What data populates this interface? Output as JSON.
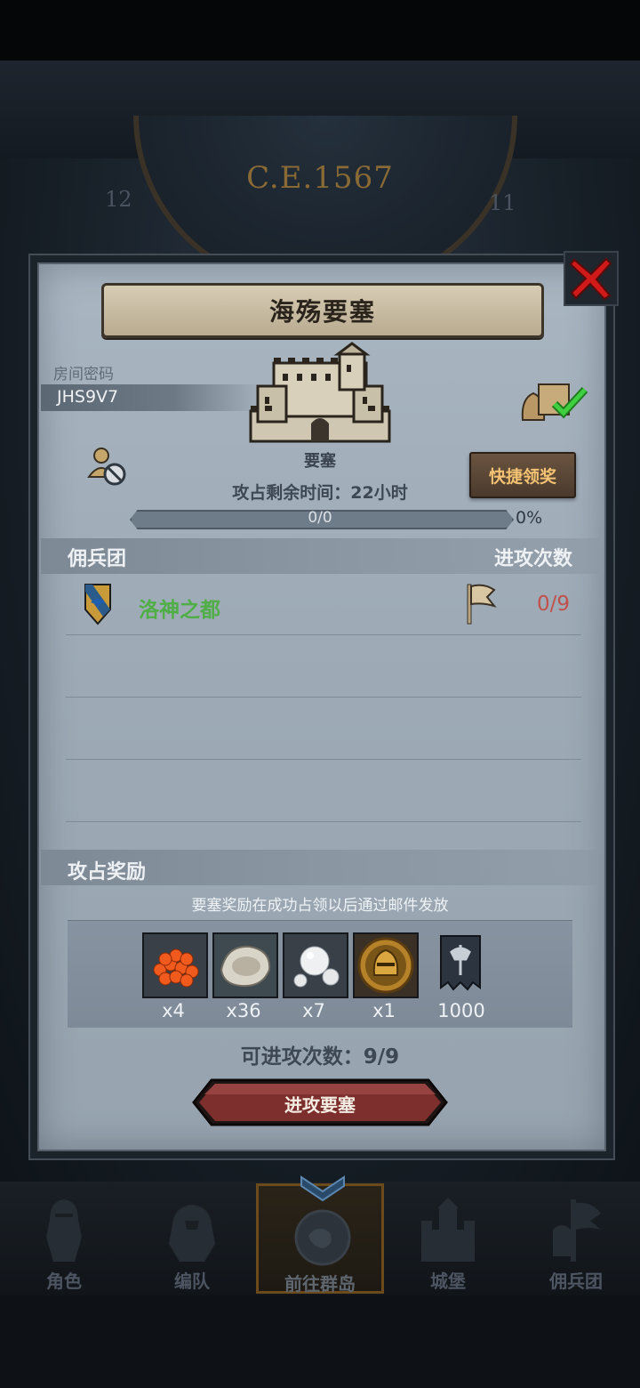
{
  "header": {
    "era": "C.E.1567",
    "dial_left": "12",
    "dial_right": "11"
  },
  "dialog": {
    "title": "海殇要塞",
    "room_label": "房间密码",
    "room_code": "JHS9V7",
    "fortress_name": "要塞",
    "quick_claim": "快捷领奖",
    "remaining_time": "攻占剩余时间：22小时",
    "progress": {
      "text": "0/0",
      "percent_text": "0%",
      "fraction": 0
    },
    "guild_header": "佣兵团",
    "attacks_header": "进攻次数",
    "guilds": [
      {
        "name": "洛神之都",
        "attacks": "0/9"
      }
    ],
    "reward_header": "攻占奖励",
    "reward_note": "要塞奖励在成功占领以后通过邮件发放",
    "rewards": [
      {
        "icon": "salmon-roe-icon",
        "qty": "x4"
      },
      {
        "icon": "oyster-icon",
        "qty": "x36"
      },
      {
        "icon": "pearl-icon",
        "qty": "x7"
      },
      {
        "icon": "knight-helmet-coin-icon",
        "qty": "x1"
      },
      {
        "icon": "war-banner-icon",
        "qty": "1000"
      }
    ],
    "can_attack": "可进攻次数：9/9",
    "attack_button": "进攻要塞"
  },
  "nav": [
    {
      "label": "角色",
      "icon": "knight-icon"
    },
    {
      "label": "编队",
      "icon": "formation-icon"
    },
    {
      "label": "前往群岛",
      "icon": "compass-icon",
      "active": true
    },
    {
      "label": "城堡",
      "icon": "castle-icon"
    },
    {
      "label": "佣兵团",
      "icon": "mercenary-icon"
    }
  ],
  "colors": {
    "accent_gold": "#f3c272",
    "guild_green": "#4fae45",
    "attack_red": "#c2504a",
    "close_red": "#d01a1a"
  }
}
